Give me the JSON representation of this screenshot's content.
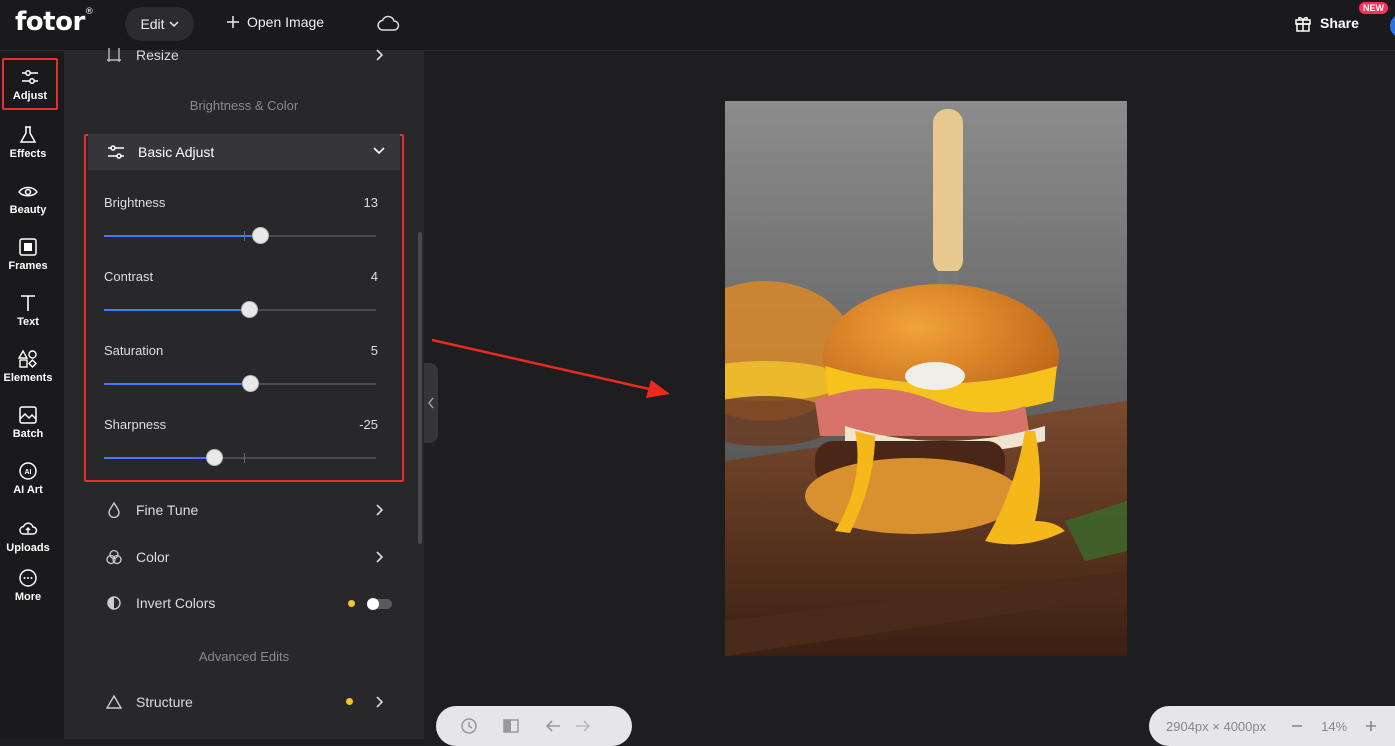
{
  "topbar": {
    "logo": "fotor",
    "logo_mark": "®",
    "edit_label": "Edit",
    "open_image_label": "Open Image",
    "share_label": "Share",
    "new_badge": "NEW"
  },
  "leftnav": {
    "items": [
      {
        "label": "Adjust",
        "icon": "sliders-icon"
      },
      {
        "label": "Effects",
        "icon": "flask-icon"
      },
      {
        "label": "Beauty",
        "icon": "eye-icon"
      },
      {
        "label": "Frames",
        "icon": "frame-icon"
      },
      {
        "label": "Text",
        "icon": "text-icon"
      },
      {
        "label": "Elements",
        "icon": "shapes-icon"
      },
      {
        "label": "Batch",
        "icon": "batch-icon"
      },
      {
        "label": "AI Art",
        "icon": "ai-icon"
      },
      {
        "label": "Uploads",
        "icon": "upload-cloud-icon"
      },
      {
        "label": "More",
        "icon": "more-icon"
      }
    ]
  },
  "panel": {
    "resize_label": "Resize",
    "section_brightness": "Brightness & Color",
    "basic_adjust_label": "Basic Adjust",
    "sliders": [
      {
        "label": "Brightness",
        "value": "13",
        "level": 13
      },
      {
        "label": "Contrast",
        "value": "4",
        "level": 4
      },
      {
        "label": "Saturation",
        "value": "5",
        "level": 5
      },
      {
        "label": "Sharpness",
        "value": "-25",
        "level": -25
      }
    ],
    "fine_tune_label": "Fine Tune",
    "color_label": "Color",
    "invert_colors_label": "Invert Colors",
    "invert_colors_on": false,
    "section_advanced": "Advanced Edits",
    "structure_label": "Structure"
  },
  "canvas": {
    "dimensions": "2904px × 4000px",
    "zoom": "14%"
  },
  "colors": {
    "accent": "#3c7bff",
    "highlight": "#e53030",
    "dot": "#f5c431"
  }
}
